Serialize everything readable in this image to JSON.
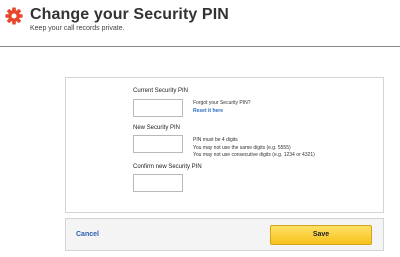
{
  "header": {
    "title": "Change your Security PIN",
    "subtitle": "Keep your call records private.",
    "icon": "gear-icon",
    "accent_color": "#e8452c"
  },
  "form": {
    "current_pin": {
      "label": "Current Security PIN",
      "value": ""
    },
    "forgot": {
      "text": "Forgot your Security PIN?",
      "link": "Reset it here"
    },
    "new_pin": {
      "label": "New Security PIN",
      "value": ""
    },
    "rules": [
      "PIN must be 4 digits",
      "You may not use the same digits (e.g. 5555)",
      "You may not use consecutive digits (e.g. 1234 or 4321)"
    ],
    "confirm_pin": {
      "label": "Confirm new Security PIN",
      "value": ""
    }
  },
  "footer": {
    "cancel_label": "Cancel",
    "save_label": "Save",
    "save_color": "#f7c21b"
  }
}
